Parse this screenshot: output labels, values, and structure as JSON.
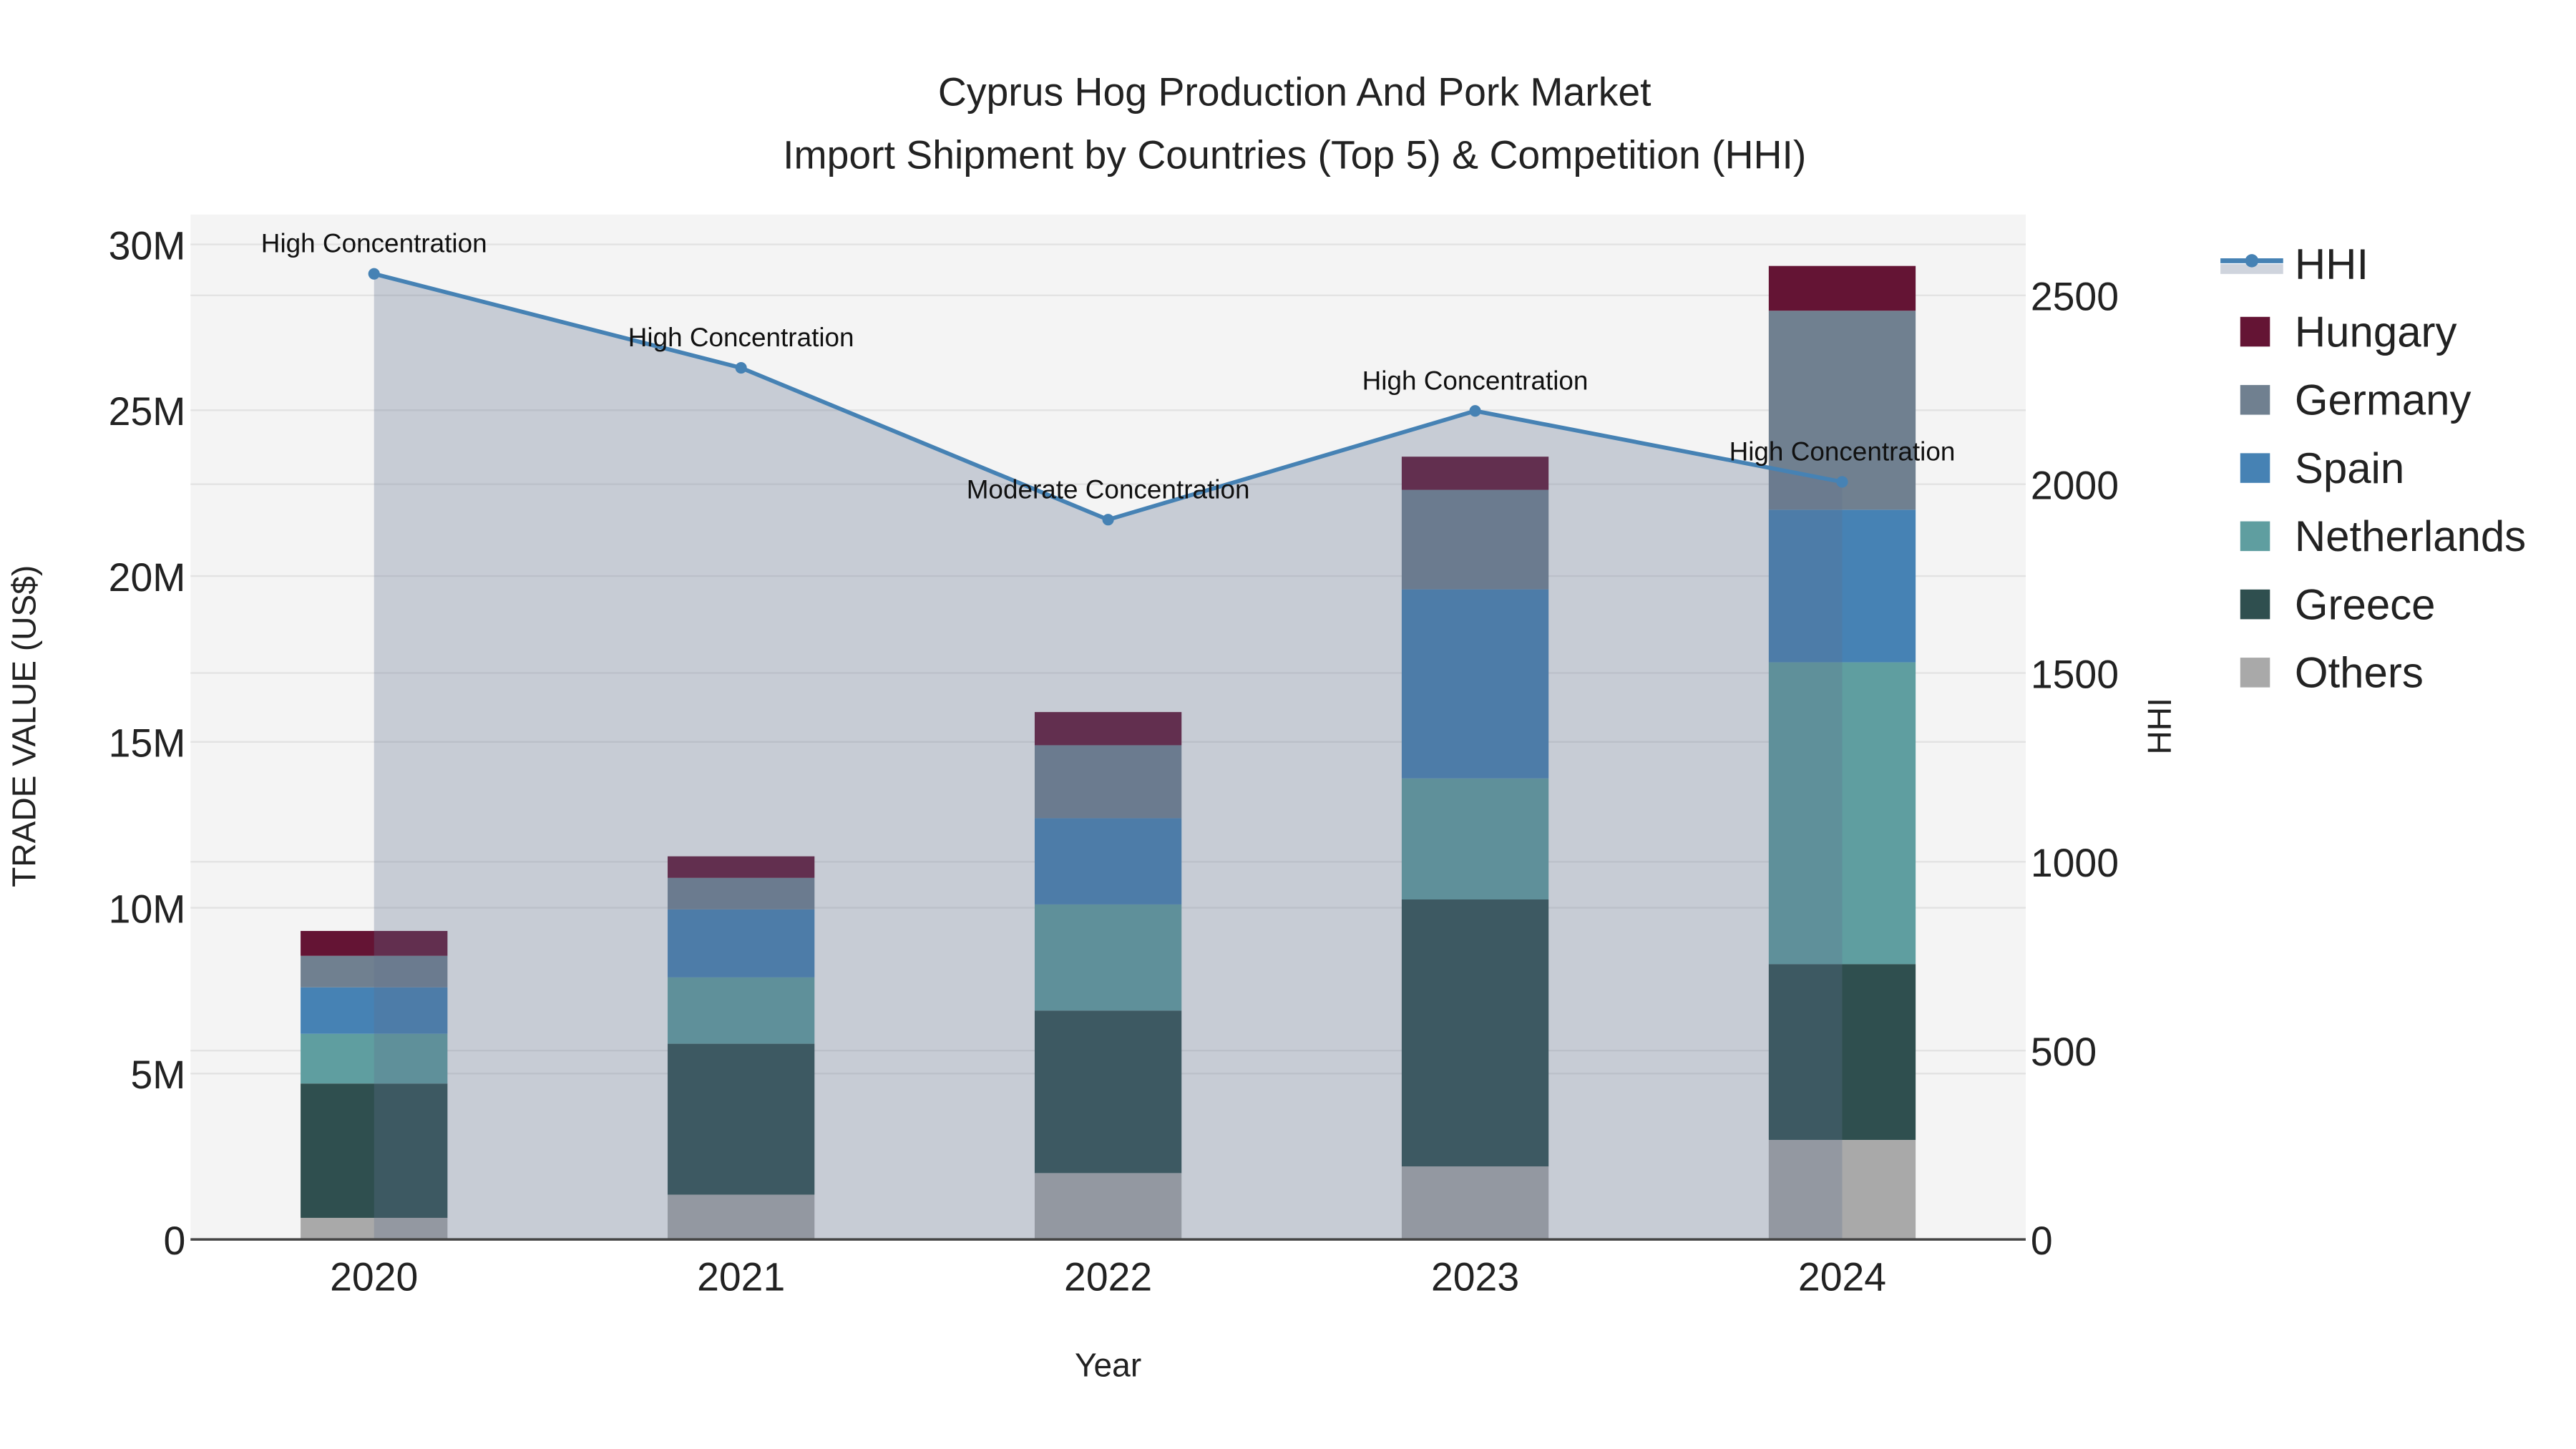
{
  "chart_data": {
    "type": "bar",
    "stacked": true,
    "title_line1": "Cyprus Hog Production And Pork Market",
    "title_line2": "Import Shipment by Countries (Top 5) & Competition (HHI)",
    "xlabel": "Year",
    "ylabel": "TRADE VALUE (US$)",
    "y2label": "HHI",
    "categories": [
      "2020",
      "2021",
      "2022",
      "2023",
      "2024"
    ],
    "ylim": [
      0,
      30900000
    ],
    "y2lim": [
      0,
      2714
    ],
    "yticks": [
      0,
      5000000,
      10000000,
      15000000,
      20000000,
      25000000,
      30000000
    ],
    "ytick_labels": [
      "0",
      "5M",
      "10M",
      "15M",
      "20M",
      "25M",
      "30M"
    ],
    "y2ticks": [
      0,
      500,
      1000,
      1500,
      2000,
      2500
    ],
    "y2tick_labels": [
      "0",
      "500",
      "1000",
      "1500",
      "2000",
      "2500"
    ],
    "series": [
      {
        "name": "Others",
        "color": "#A9A9A9",
        "values": [
          650000,
          1350000,
          2000000,
          2200000,
          3000000
        ]
      },
      {
        "name": "Greece",
        "color": "#2F4F4F",
        "values": [
          4050000,
          4550000,
          4900000,
          8050000,
          5300000
        ]
      },
      {
        "name": "Netherlands",
        "color": "#5F9EA0",
        "values": [
          1500000,
          2000000,
          3200000,
          3650000,
          9100000
        ]
      },
      {
        "name": "Spain",
        "color": "#4682B4",
        "values": [
          1400000,
          2050000,
          2600000,
          5700000,
          4600000
        ]
      },
      {
        "name": "Germany",
        "color": "#708090",
        "values": [
          950000,
          950000,
          2200000,
          3000000,
          6000000
        ]
      },
      {
        "name": "Hungary",
        "color": "#641434",
        "values": [
          750000,
          650000,
          1000000,
          1000000,
          1350000
        ]
      }
    ],
    "line_series": {
      "name": "HHI",
      "color": "#4682B4",
      "axis": "right",
      "values": [
        2557,
        2308,
        1906,
        2194,
        2006
      ],
      "annotations": [
        "High Concentration",
        "High Concentration",
        "Moderate Concentration",
        "High Concentration",
        "High Concentration"
      ]
    },
    "legend_order": [
      "HHI",
      "Hungary",
      "Germany",
      "Spain",
      "Netherlands",
      "Greece",
      "Others"
    ],
    "legend_position": "right",
    "grid": true
  }
}
